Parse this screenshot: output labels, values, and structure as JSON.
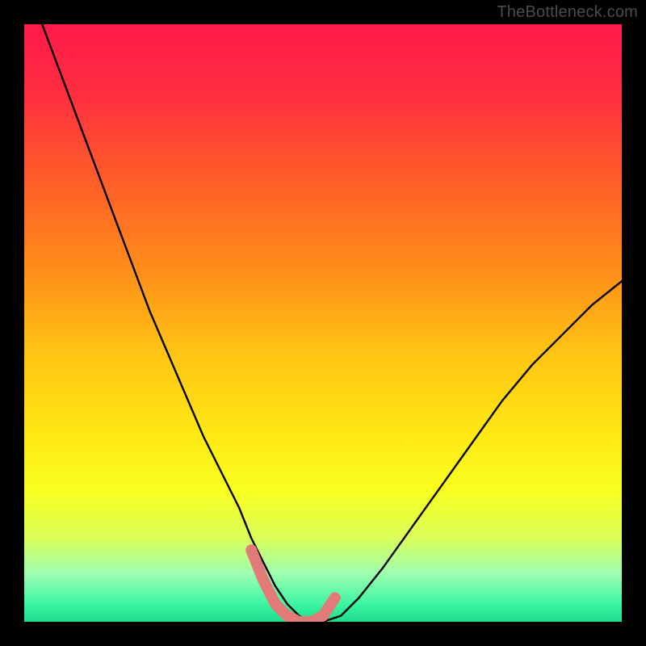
{
  "watermark": "TheBottleneck.com",
  "colors": {
    "frame": "#000000",
    "gradient_stops": [
      {
        "offset": 0.0,
        "color": "#ff1a4a"
      },
      {
        "offset": 0.12,
        "color": "#ff2f3f"
      },
      {
        "offset": 0.25,
        "color": "#ff5a2a"
      },
      {
        "offset": 0.4,
        "color": "#ff8a1a"
      },
      {
        "offset": 0.55,
        "color": "#ffc414"
      },
      {
        "offset": 0.68,
        "color": "#ffe714"
      },
      {
        "offset": 0.78,
        "color": "#f9ff1e"
      },
      {
        "offset": 0.86,
        "color": "#d9ff5a"
      },
      {
        "offset": 0.92,
        "color": "#9dffb0"
      },
      {
        "offset": 0.97,
        "color": "#3cf5a3"
      },
      {
        "offset": 1.0,
        "color": "#1ddc8c"
      }
    ],
    "curve": "#000000",
    "highlight": "#e27b78"
  },
  "chart_data": {
    "type": "line",
    "title": "",
    "xlabel": "",
    "ylabel": "",
    "xlim": [
      0,
      100
    ],
    "ylim": [
      0,
      100
    ],
    "grid": false,
    "legend": false,
    "series": [
      {
        "name": "bottleneck-curve",
        "x": [
          3,
          6,
          9,
          12,
          15,
          18,
          21,
          24,
          27,
          30,
          33,
          36,
          38,
          40,
          42,
          44,
          46,
          48,
          50,
          53,
          56,
          60,
          65,
          70,
          75,
          80,
          85,
          90,
          95,
          100
        ],
        "y": [
          100,
          92,
          84,
          76,
          68,
          60,
          52,
          45,
          38,
          31,
          25,
          19,
          14,
          10,
          6,
          3,
          1,
          0,
          0,
          1,
          4,
          9,
          16,
          23,
          30,
          37,
          43,
          48,
          53,
          57
        ]
      }
    ],
    "highlight_segment": {
      "x": [
        38,
        40,
        42,
        44,
        46,
        48,
        50,
        52
      ],
      "y": [
        12,
        7,
        3,
        1,
        0,
        0,
        1,
        4
      ]
    }
  }
}
